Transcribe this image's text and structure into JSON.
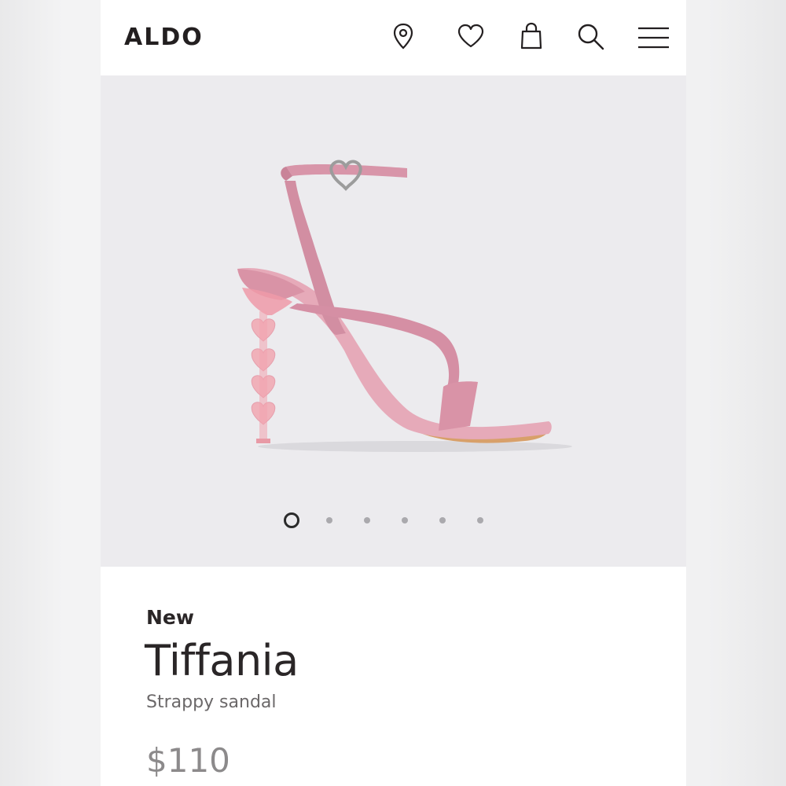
{
  "header": {
    "logo": "ALDO",
    "icons": [
      "location-pin-icon",
      "heart-icon",
      "shopping-bag-icon",
      "search-icon",
      "menu-icon"
    ]
  },
  "gallery": {
    "image_count": 6,
    "active_index": 0
  },
  "product": {
    "badge": "New",
    "name": "Tiffania",
    "subtitle": "Strappy sandal",
    "price": "$110"
  },
  "colors": {
    "text_primary": "#231f20",
    "gallery_bg": "#ecebee",
    "shoe_pink": "#e3a9b9",
    "price_grey": "#8c8a8b"
  }
}
